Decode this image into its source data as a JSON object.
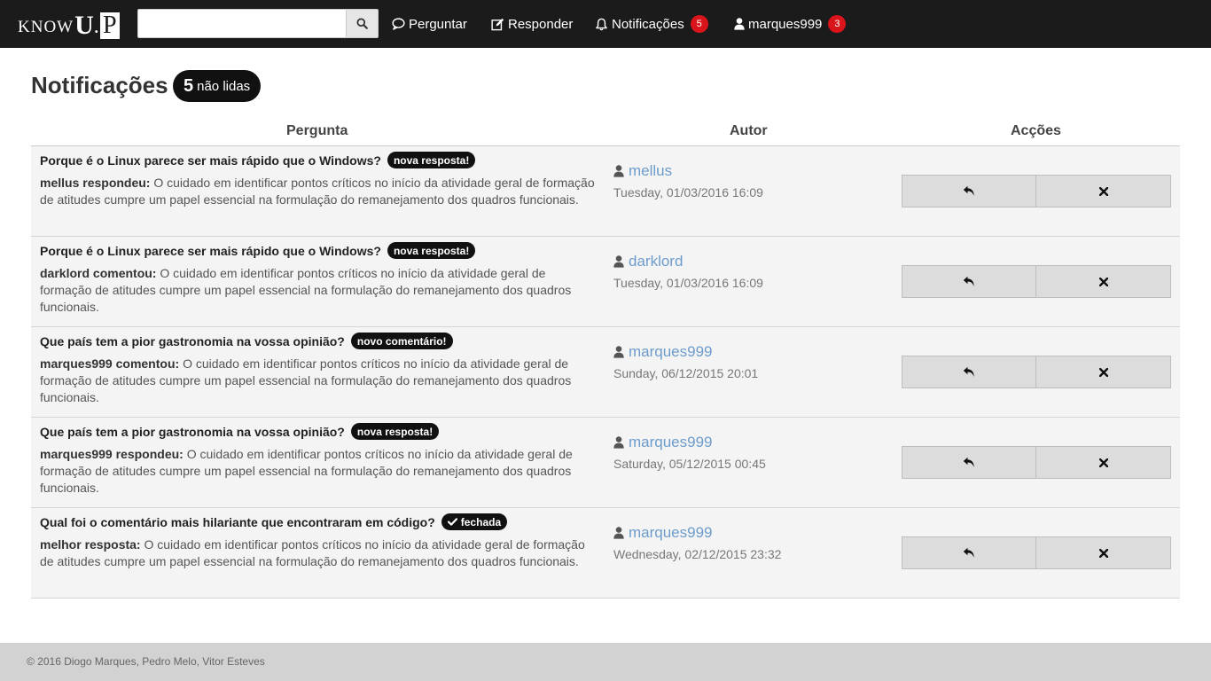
{
  "navbar": {
    "logo": {
      "know": "KNOW",
      "u": "U",
      "dot": ".",
      "p": "P"
    },
    "search": {
      "placeholder": "",
      "value": ""
    },
    "links": [
      {
        "label": "Perguntar",
        "icon": "comment-icon"
      },
      {
        "label": "Responder",
        "icon": "edit-icon"
      },
      {
        "label": "Notificações",
        "icon": "bell-icon",
        "badge": "5"
      },
      {
        "label": "marques999",
        "icon": "user-icon",
        "badge": "3"
      }
    ]
  },
  "header": {
    "title": "Notificações",
    "unread_count": "5",
    "unread_label": "não lidas"
  },
  "table": {
    "columns": [
      "Pergunta",
      "Autor",
      "Acções"
    ],
    "rows": [
      {
        "question": "Porque é o Linux parece ser mais rápido que o Windows?",
        "tag": "nova resposta!",
        "action": "mellus respondeu:",
        "body": "O cuidado em identificar pontos críticos no início da atividade geral de formação de atitudes cumpre um papel essencial na formulação do remanejamento dos quadros funcionais.",
        "author": "mellus",
        "date": "Tuesday, 01/03/2016 16:09"
      },
      {
        "question": "Porque é o Linux parece ser mais rápido que o Windows?",
        "tag": "nova resposta!",
        "action": "darklord comentou:",
        "body": "O cuidado em identificar pontos críticos no início da atividade geral de formação de atitudes cumpre um papel essencial na formulação do remanejamento dos quadros funcionais.",
        "author": "darklord",
        "date": "Tuesday, 01/03/2016 16:09"
      },
      {
        "question": "Que país tem a pior gastronomia na vossa opinião?",
        "tag": "novo comentário!",
        "action": "marques999 comentou:",
        "body": "O cuidado em identificar pontos críticos no início da atividade geral de formação de atitudes cumpre um papel essencial na formulação do remanejamento dos quadros funcionais.",
        "author": "marques999",
        "date": "Sunday, 06/12/2015 20:01"
      },
      {
        "question": "Que país tem a pior gastronomia na vossa opinião?",
        "tag": "nova resposta!",
        "action": "marques999 respondeu:",
        "body": "O cuidado em identificar pontos críticos no início da atividade geral de formação de atitudes cumpre um papel essencial na formulação do remanejamento dos quadros funcionais.",
        "author": "marques999",
        "date": "Saturday, 05/12/2015 00:45"
      },
      {
        "question": "Qual foi o comentário mais hilariante que encontraram em código?",
        "tag": "fechada",
        "tag_icon": "check-icon",
        "action": "melhor resposta:",
        "body": "O cuidado em identificar pontos críticos no início da atividade geral de formação de atitudes cumpre um papel essencial na formulação do remanejamento dos quadros funcionais.",
        "author": "marques999",
        "date": "Wednesday, 02/12/2015 23:32"
      }
    ],
    "action_icons": [
      "reply-icon",
      "close-icon"
    ]
  },
  "footer": {
    "text": "© 2016 Diogo Marques, Pedro Melo, Vitor Esteves"
  },
  "colors": {
    "navbar": "#1b1b1b",
    "badge": "#d9141a",
    "link": "#6d9ccc",
    "row_bg": "#f4f4f4",
    "footer": "#d2d2d2"
  }
}
